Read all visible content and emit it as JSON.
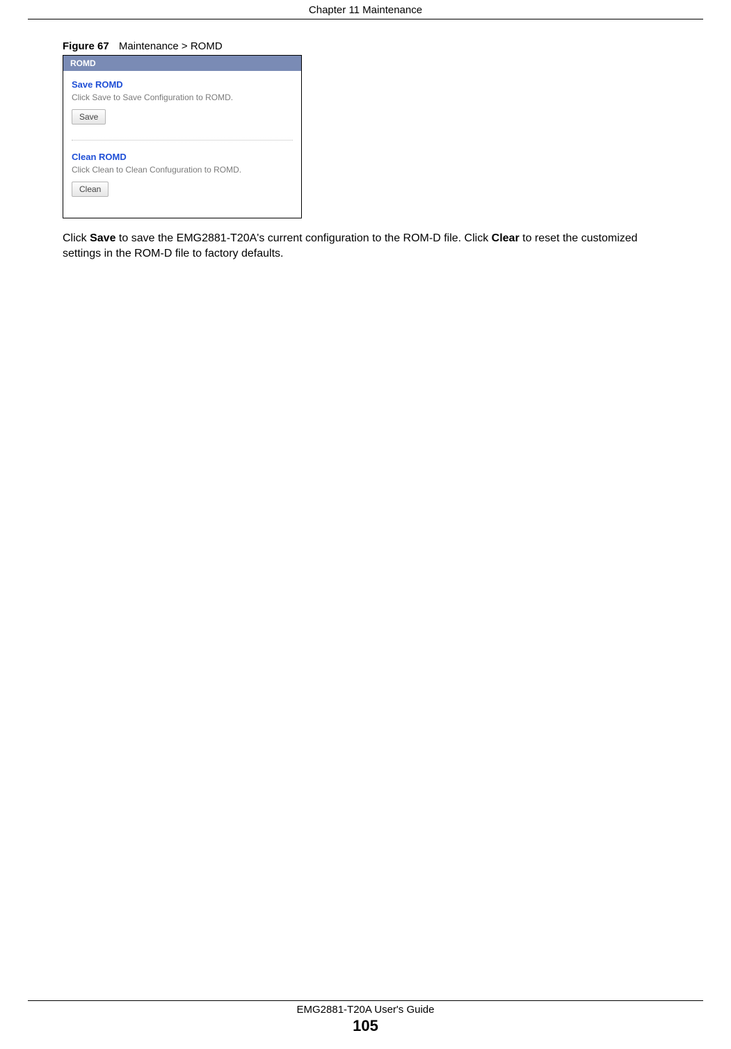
{
  "header": {
    "chapter": "Chapter 11 Maintenance"
  },
  "figure": {
    "label": "Figure 67",
    "caption": "Maintenance > ROMD"
  },
  "screenshot": {
    "panel_title": "ROMD",
    "save": {
      "title": "Save ROMD",
      "desc": "Click Save to Save Configuration to ROMD.",
      "button": "Save"
    },
    "clean": {
      "title": "Clean ROMD",
      "desc": "Click Clean to Clean Confuguration to ROMD.",
      "button": "Clean"
    }
  },
  "paragraph": {
    "p1a": "Click ",
    "p1b": "Save",
    "p1c": " to save the EMG2881-T20A's current configuration to the ROM-D file. Click ",
    "p1d": "Clear",
    "p1e": " to reset the customized settings in the ROM-D file to factory defaults."
  },
  "footer": {
    "guide": "EMG2881-T20A User's Guide",
    "page": "105"
  }
}
